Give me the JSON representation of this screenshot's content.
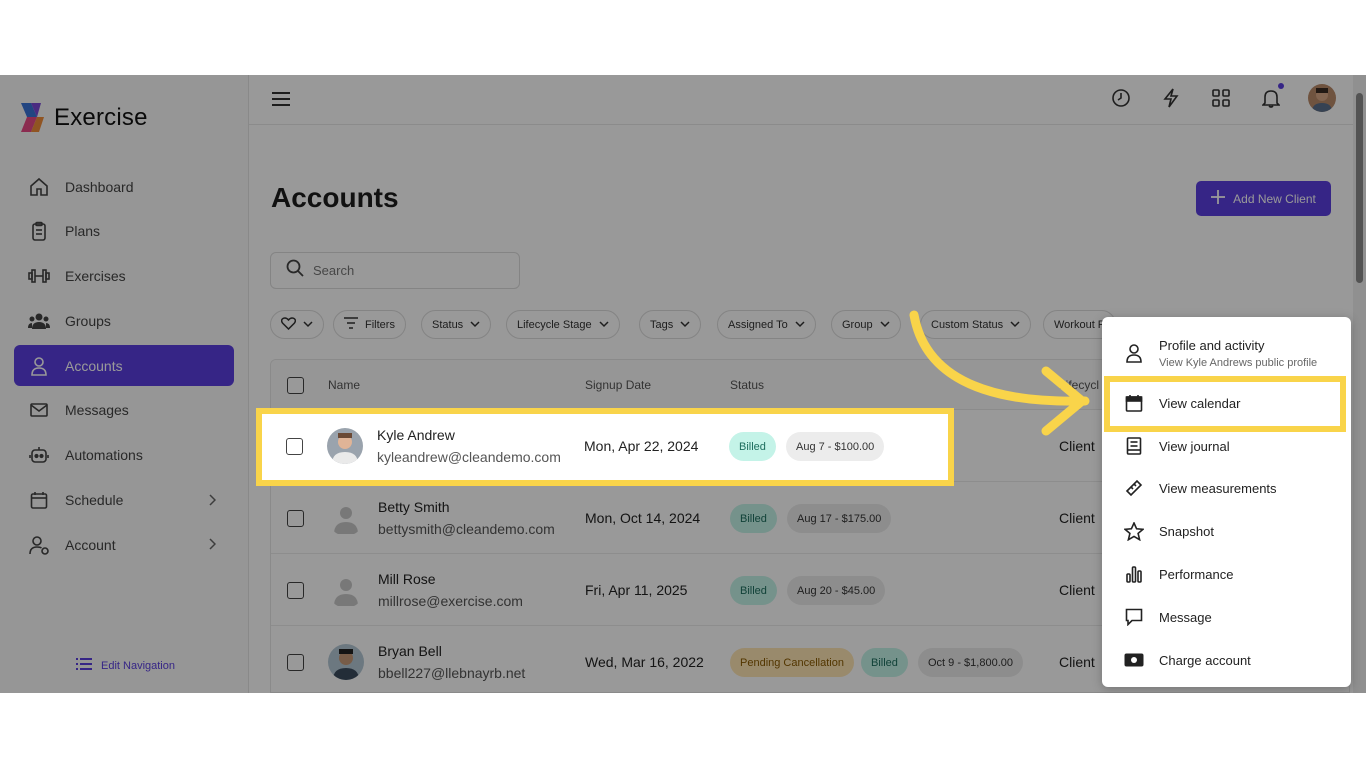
{
  "app": {
    "name": "Exercise"
  },
  "sidebar": {
    "items": [
      {
        "label": "Dashboard"
      },
      {
        "label": "Plans"
      },
      {
        "label": "Exercises"
      },
      {
        "label": "Groups"
      },
      {
        "label": "Accounts"
      },
      {
        "label": "Messages"
      },
      {
        "label": "Automations"
      },
      {
        "label": "Schedule"
      },
      {
        "label": "Account"
      }
    ],
    "edit_navigation": "Edit Navigation"
  },
  "page": {
    "title": "Accounts",
    "add_button": "Add New Client",
    "search_placeholder": "Search"
  },
  "filters": [
    "Filters",
    "Status",
    "Lifecycle Stage",
    "Tags",
    "Assigned To",
    "Group",
    "Custom Status",
    "Workout P"
  ],
  "table": {
    "columns": {
      "name": "Name",
      "signup": "Signup Date",
      "status": "Status",
      "lifecycle": "Lifecycl"
    },
    "rows": [
      {
        "name": "Kyle Andrew",
        "email": "kyleandrew@cleandemo.com",
        "date": "Mon, Apr 22, 2024",
        "badges": [
          "Billed",
          "Aug 7 - $100.00"
        ],
        "lifecycle": "Client"
      },
      {
        "name": "Betty Smith",
        "email": "bettysmith@cleandemo.com",
        "date": "Mon, Oct 14, 2024",
        "badges": [
          "Billed",
          "Aug 17 - $175.00"
        ],
        "lifecycle": "Client"
      },
      {
        "name": "Mill Rose",
        "email": "millrose@exercise.com",
        "date": "Fri, Apr 11, 2025",
        "badges": [
          "Billed",
          "Aug 20 - $45.00"
        ],
        "lifecycle": "Client"
      },
      {
        "name": "Bryan Bell",
        "email": "bbell227@llebnayrb.net",
        "date": "Wed, Mar 16, 2022",
        "badges": [
          "Pending Cancellation",
          "Billed",
          "Oct 9 - $1,800.00"
        ],
        "lifecycle": "Client"
      }
    ]
  },
  "menu": {
    "profile": {
      "label": "Profile and activity",
      "sub": "View Kyle Andrews public profile"
    },
    "items": [
      {
        "label": "View calendar",
        "icon": "calendar-icon"
      },
      {
        "label": "View journal",
        "icon": "journal-icon"
      },
      {
        "label": "View measurements",
        "icon": "ruler-icon"
      },
      {
        "label": "Snapshot",
        "icon": "star-icon"
      },
      {
        "label": "Performance",
        "icon": "bar-chart-icon"
      },
      {
        "label": "Message",
        "icon": "message-icon"
      },
      {
        "label": "Charge account",
        "icon": "money-icon"
      }
    ]
  },
  "colors": {
    "accent": "#5b3fe0",
    "highlight": "#f9d44a",
    "billed_bg": "#c4f3e8",
    "pending_bg": "#ffe6b5"
  }
}
